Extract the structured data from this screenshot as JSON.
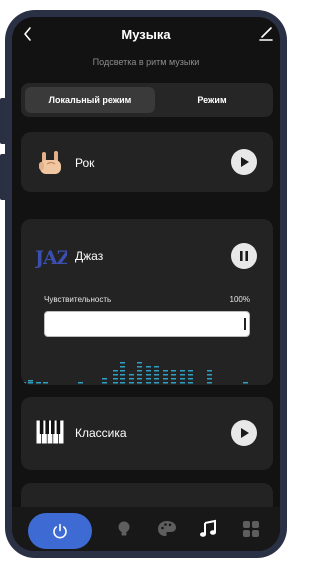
{
  "header": {
    "title": "Музыка",
    "subtitle": "Подсветка в ритм музыки"
  },
  "mode_toggle": {
    "local_label": "Локальный режим",
    "mode_label": "Режим",
    "selected": "local"
  },
  "genres": [
    {
      "label": "Рок",
      "icon": "rock-hand-icon",
      "state": "play"
    },
    {
      "label": "Джаз",
      "icon": "jazz-logo-icon",
      "logo_text": "JAZZ",
      "state": "pause"
    },
    {
      "label": "Классика",
      "icon": "piano-keys-icon",
      "state": "play"
    }
  ],
  "sensitivity": {
    "label": "Чувствительность",
    "value_text": "100%",
    "value": 1.0
  },
  "tabbar": {
    "items": [
      "power-icon",
      "bulb-icon",
      "palette-icon",
      "music-note-icon",
      "grid-icon"
    ],
    "active": "music-note-icon"
  },
  "colors": {
    "accent": "#3d6bd3",
    "equalizer": "#2f9fc4",
    "jazz_logo": "#3b4fb0"
  }
}
